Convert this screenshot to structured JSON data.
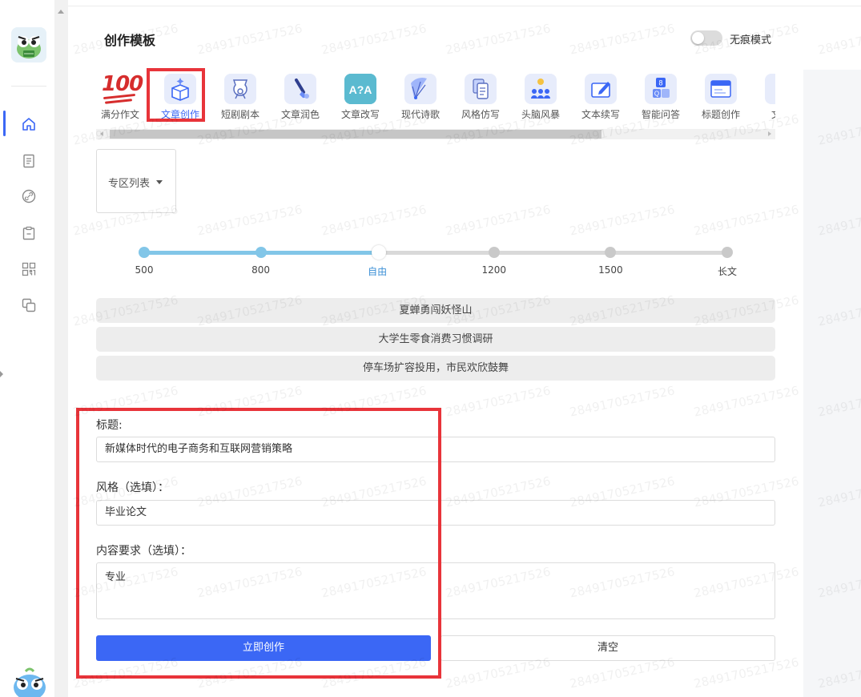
{
  "page": {
    "title": "创作模板",
    "incognito_label": "无痕模式",
    "incognito_on": false
  },
  "templates": [
    {
      "label": "满分作文",
      "icon": "hundred-points-icon",
      "active": false
    },
    {
      "label": "文章创作",
      "icon": "box-sparkle-icon",
      "active": true
    },
    {
      "label": "短剧剧本",
      "icon": "film-reel-icon",
      "active": false
    },
    {
      "label": "文章润色",
      "icon": "brush-icon",
      "active": false
    },
    {
      "label": "文章改写",
      "icon": "translate-icon",
      "active": false
    },
    {
      "label": "现代诗歌",
      "icon": "fan-icon",
      "active": false
    },
    {
      "label": "风格仿写",
      "icon": "documents-icon",
      "active": false
    },
    {
      "label": "头脑风暴",
      "icon": "team-idea-icon",
      "active": false
    },
    {
      "label": "文本续写",
      "icon": "edit-box-icon",
      "active": false
    },
    {
      "label": "智能问答",
      "icon": "qa-cards-icon",
      "active": false
    },
    {
      "label": "标题创作",
      "icon": "title-window-icon",
      "active": false
    },
    {
      "label": "文章",
      "icon": "document-icon",
      "active": false
    }
  ],
  "zone_list": {
    "label": "专区列表"
  },
  "length_slider": {
    "stops": [
      "500",
      "800",
      "自由",
      "1200",
      "1500",
      "长文"
    ],
    "selected_index": 2
  },
  "suggestions": [
    "夏蝉勇闯妖怪山",
    "大学生零食消费习惯调研",
    "停车场扩容投用，市民欢欣鼓舞"
  ],
  "form": {
    "title_label": "标题:",
    "title_value": "新媒体时代的电子商务和互联网营销策略",
    "style_label": "风格（选填）：",
    "style_value": "毕业论文",
    "content_label": "内容要求（选填）：",
    "content_value": "专业",
    "create_button": "立即创作",
    "clear_button": "清空"
  },
  "sidebar": {
    "items": [
      {
        "icon": "home-icon",
        "active": true
      },
      {
        "icon": "document-list-icon",
        "active": false
      },
      {
        "icon": "link-icon",
        "active": false
      },
      {
        "icon": "clipboard-icon",
        "active": false
      },
      {
        "icon": "grid-apps-icon",
        "active": false
      },
      {
        "icon": "copy-icon",
        "active": false
      }
    ]
  },
  "watermark_text": "28491705217526",
  "colors": {
    "accent": "#3b67f5",
    "highlight_box": "#e8343a",
    "slider_fill": "#82c6e8"
  }
}
